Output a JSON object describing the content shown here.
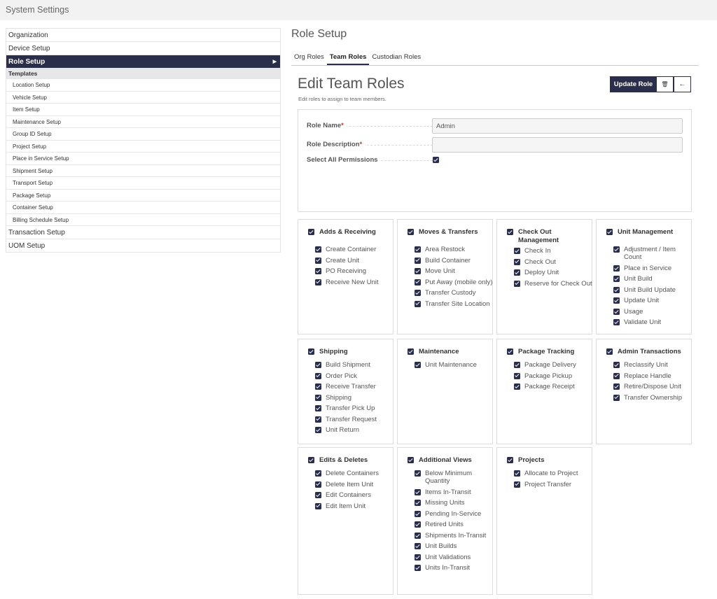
{
  "header": {
    "title": "System Settings"
  },
  "sidebar": {
    "top_items": [
      "Organization",
      "Device Setup"
    ],
    "active_item": "Role Setup",
    "section_header": "Templates",
    "sub_items": [
      "Location Setup",
      "Vehicle Setup",
      "Item Setup",
      "Maintenance Setup",
      "Group ID Setup",
      "Project Setup",
      "Place in Service Setup",
      "Shipment Setup",
      "Transport Setup",
      "Package Setup",
      "Container Setup",
      "Billing Schedule Setup"
    ],
    "bottom_items": [
      "Transaction Setup",
      "UOM Setup"
    ]
  },
  "page": {
    "title": "Role Setup",
    "tabs": [
      {
        "label": "Org Roles",
        "active": false
      },
      {
        "label": "Team Roles",
        "active": true
      },
      {
        "label": "Custodian Roles",
        "active": false
      }
    ],
    "edit_title": "Edit Team Roles",
    "edit_subtitle": "Edit roles to assign to team members.",
    "buttons": {
      "update": "Update Role",
      "delete_icon": "🗑",
      "back_icon": "←"
    }
  },
  "form": {
    "role_name_label": "Role Name",
    "role_name_value": "Admin",
    "role_description_label": "Role Description",
    "role_description_value": "",
    "required_mark": "*",
    "select_all_label": "Select All Permissions",
    "select_all_checked": true
  },
  "permission_groups": [
    {
      "title": "Adds & Receiving",
      "items": [
        "Create Container",
        "Create Unit",
        "PO Receiving",
        "Receive New Unit"
      ]
    },
    {
      "title": "Moves & Transfers",
      "items": [
        "Area Restock",
        "Build Container",
        "Move Unit",
        "Put Away (mobile only)",
        "Transfer Custody",
        "Transfer Site Location"
      ]
    },
    {
      "title": "Check Out Management",
      "items": [
        "Check In",
        "Check Out",
        "Deploy Unit",
        "Reserve for Check Out"
      ]
    },
    {
      "title": "Unit Management",
      "items": [
        "Adjustment / Item Count",
        "Place in Service",
        "Unit Build",
        "Unit Build Update",
        "Update Unit",
        "Usage",
        "Validate Unit"
      ]
    },
    {
      "title": "Shipping",
      "items": [
        "Build Shipment",
        "Order Pick",
        "Receive Transfer",
        "Shipping",
        "Transfer Pick Up",
        "Transfer Request",
        "Unit Return"
      ]
    },
    {
      "title": "Maintenance",
      "items": [
        "Unit Maintenance"
      ]
    },
    {
      "title": "Package Tracking",
      "items": [
        "Package Delivery",
        "Package Pickup",
        "Package Receipt"
      ]
    },
    {
      "title": "Admin Transactions",
      "items": [
        "Reclassify Unit",
        "Replace Handle",
        "Retire/Dispose Unit",
        "Transfer Ownership"
      ]
    },
    {
      "title": "Edits & Deletes",
      "items": [
        "Delete Containers",
        "Delete Item Unit",
        "Edit Containers",
        "Edit Item Unit"
      ]
    },
    {
      "title": "Additional Views",
      "items": [
        "Below Minimum Quantity",
        "Items In-Transit",
        "Missing Units",
        "Pending In-Service",
        "Retired Units",
        "Shipments In-Transit",
        "Unit Builds",
        "Unit Validations",
        "Units In-Transit"
      ]
    },
    {
      "title": "Projects",
      "items": [
        "Allocate to Project",
        "Project Transfer"
      ]
    }
  ],
  "colors": {
    "primary": "#2b2e4a",
    "required": "#c0392b",
    "border": "#dddddd"
  }
}
